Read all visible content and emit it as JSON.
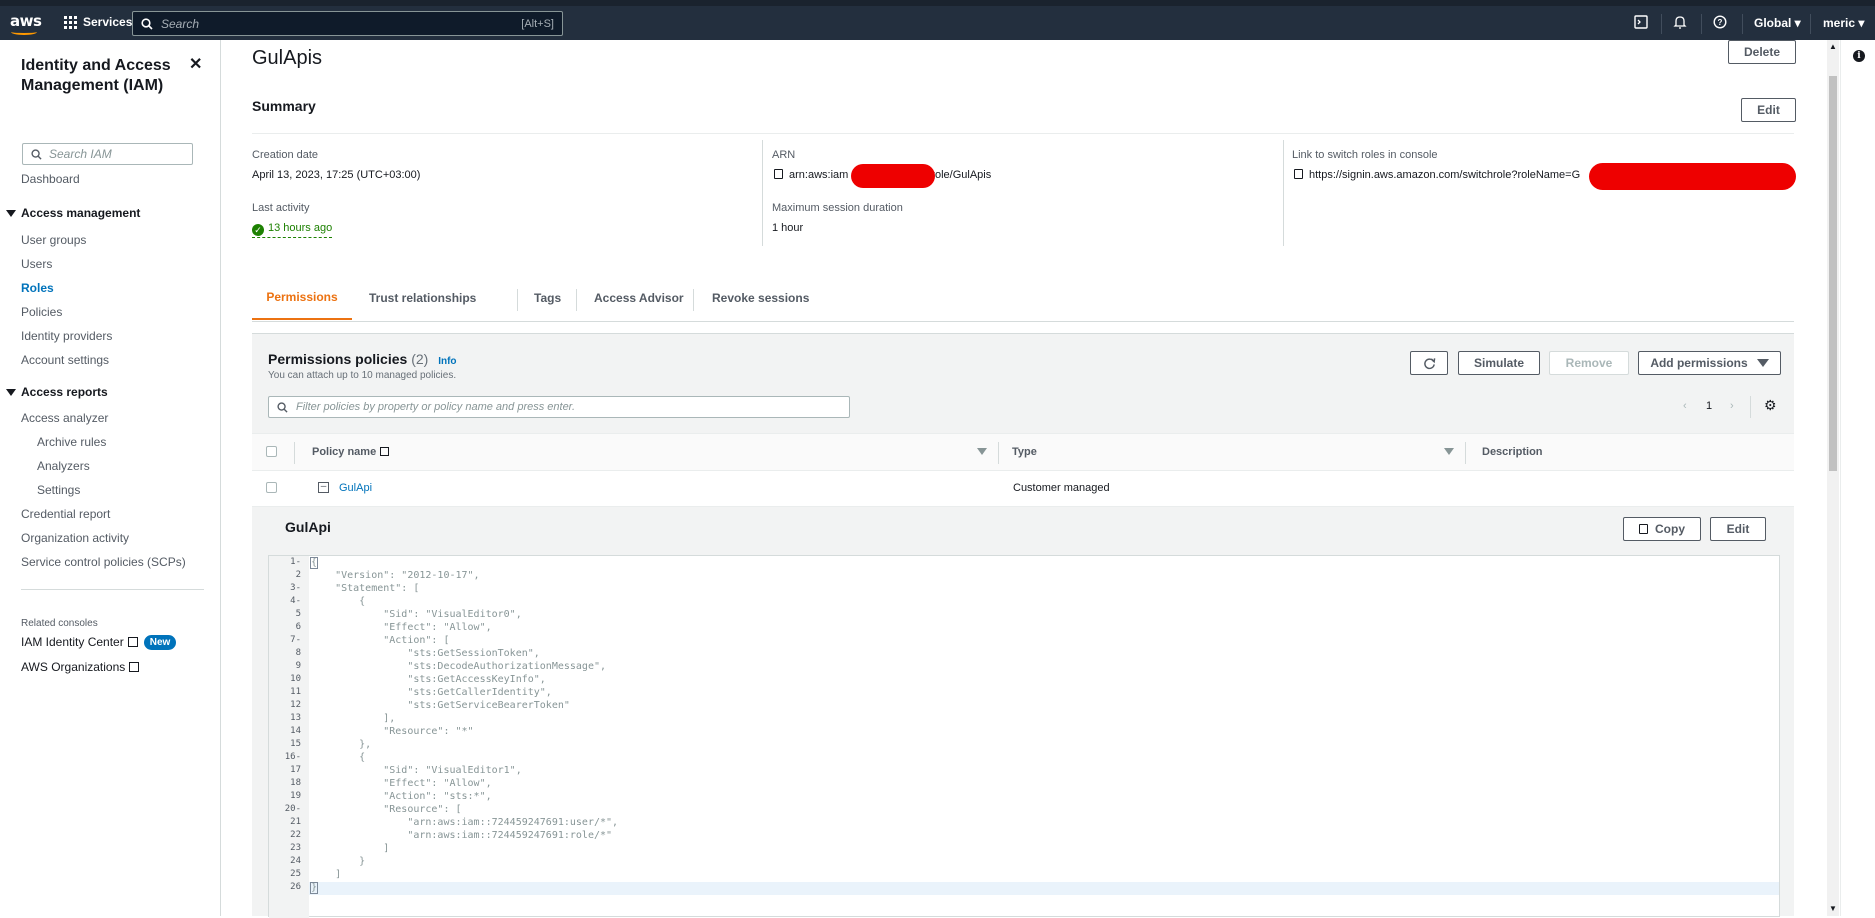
{
  "topnav": {
    "logo_text": "aws",
    "services_label": "Services",
    "search_placeholder": "Search",
    "search_shortcut": "[Alt+S]",
    "region_label": "Global",
    "account_label": "meric",
    "icons": [
      "cloudshell-icon",
      "bell-icon",
      "help-icon"
    ]
  },
  "sidebar": {
    "title": "Identity and Access Management (IAM)",
    "search_placeholder": "Search IAM",
    "dashboard": "Dashboard",
    "access_management": {
      "label": "Access management",
      "items": [
        "User groups",
        "Users",
        "Roles",
        "Policies",
        "Identity providers",
        "Account settings"
      ],
      "active": "Roles"
    },
    "access_reports": {
      "label": "Access reports",
      "analyzer": "Access analyzer",
      "sub_items": [
        "Archive rules",
        "Analyzers",
        "Settings"
      ],
      "items": [
        "Credential report",
        "Organization activity",
        "Service control policies (SCPs)"
      ]
    },
    "related_label": "Related consoles",
    "related": [
      {
        "label": "IAM Identity Center",
        "badge": "New"
      },
      {
        "label": "AWS Organizations",
        "badge": ""
      }
    ]
  },
  "page": {
    "title": "GulApis",
    "delete_label": "Delete",
    "edit_label": "Edit"
  },
  "summary": {
    "heading": "Summary",
    "creation_date_label": "Creation date",
    "creation_date": "April 13, 2023, 17:25 (UTC+03:00)",
    "last_activity_label": "Last activity",
    "last_activity": "13 hours ago",
    "arn_label": "ARN",
    "arn_prefix": "arn:aws:iam",
    "arn_suffix": "role/GulApis",
    "max_session_label": "Maximum session duration",
    "max_session": "1 hour",
    "switch_label": "Link to switch roles in console",
    "switch_link": "https://signin.aws.amazon.com/switchrole?roleName=G"
  },
  "tabs": [
    {
      "label": "Permissions",
      "active": true
    },
    {
      "label": "Trust relationships",
      "active": false
    },
    {
      "label": "Tags",
      "active": false
    },
    {
      "label": "Access Advisor",
      "active": false
    },
    {
      "label": "Revoke sessions",
      "active": false
    }
  ],
  "permissions": {
    "heading": "Permissions policies",
    "count": "(2)",
    "info": "Info",
    "subtitle": "You can attach up to 10 managed policies.",
    "simulate_label": "Simulate",
    "remove_label": "Remove",
    "add_label": "Add permissions",
    "filter_placeholder": "Filter policies by property or policy name and press enter.",
    "page_number": "1",
    "columns": [
      "Policy name",
      "Type",
      "Description"
    ],
    "rows": [
      {
        "name": "GulApi",
        "type": "Customer managed",
        "description": ""
      }
    ]
  },
  "policy_detail": {
    "title": "GulApi",
    "copy_label": "Copy",
    "edit_label": "Edit",
    "lines": [
      "{",
      "    \"Version\": \"2012-10-17\",",
      "    \"Statement\": [",
      "        {",
      "            \"Sid\": \"VisualEditor0\",",
      "            \"Effect\": \"Allow\",",
      "            \"Action\": [",
      "                \"sts:GetSessionToken\",",
      "                \"sts:DecodeAuthorizationMessage\",",
      "                \"sts:GetAccessKeyInfo\",",
      "                \"sts:GetCallerIdentity\",",
      "                \"sts:GetServiceBearerToken\"",
      "            ],",
      "            \"Resource\": \"*\"",
      "        },",
      "        {",
      "            \"Sid\": \"VisualEditor1\",",
      "            \"Effect\": \"Allow\",",
      "            \"Action\": \"sts:*\",",
      "            \"Resource\": [",
      "                \"arn:aws:iam::724459247691:user/*\",",
      "                \"arn:aws:iam::724459247691:role/*\"",
      "            ]",
      "        }",
      "    ]",
      "}"
    ],
    "foldable_lines": [
      1,
      3,
      4,
      7,
      16,
      20
    ]
  },
  "colors": {
    "nav_bg": "#232f3e",
    "active_tab": "#ec7211",
    "link": "#0073bb",
    "success": "#1d8102",
    "redaction": "#ee0000"
  }
}
